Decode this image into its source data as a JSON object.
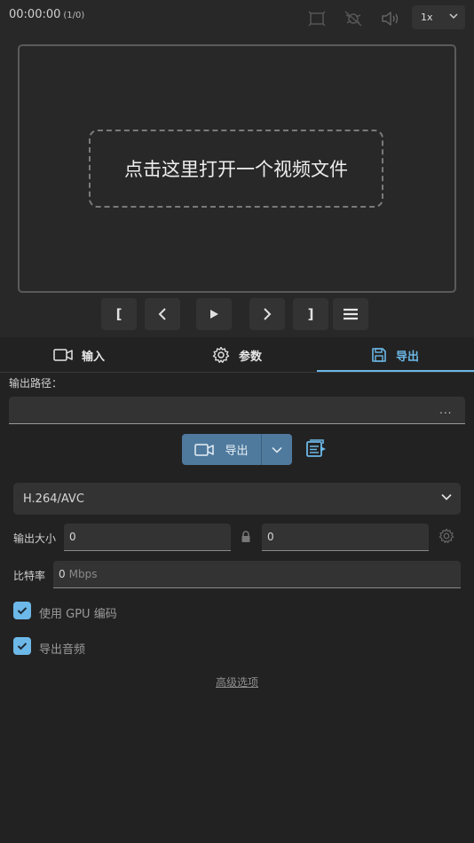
{
  "topbar": {
    "timecode": "00:00:00",
    "frame_counter": "(1/0)",
    "icons": [
      "crop-icon",
      "disabled-transform-icon",
      "volume-icon"
    ],
    "speed": "1x"
  },
  "preview": {
    "placeholder": "点击这里打开一个视频文件"
  },
  "transport": {
    "mark_in": "[",
    "mark_out": "]"
  },
  "tabs": [
    {
      "label": "输入",
      "icon": "video-camera-icon"
    },
    {
      "label": "参数",
      "icon": "gear-icon"
    },
    {
      "label": "导出",
      "icon": "save-icon",
      "active": true
    }
  ],
  "export": {
    "path_label": "输出路径：",
    "path_value": "",
    "browse_label": "...",
    "export_button": "导出",
    "codec": "H.264/AVC",
    "size_label": "输出大小",
    "width": "0",
    "height": "0",
    "bitrate_label": "比特率",
    "bitrate_value": "0",
    "bitrate_unit": "Mbps",
    "gpu_label": "使用 GPU 编码",
    "gpu_checked": true,
    "audio_label": "导出音频",
    "audio_checked": true,
    "advanced_link": "高级选项"
  },
  "colors": {
    "accent": "#6cb8e8",
    "export_button": "#4f7a9d",
    "background": "#282828",
    "panel": "#222222"
  }
}
